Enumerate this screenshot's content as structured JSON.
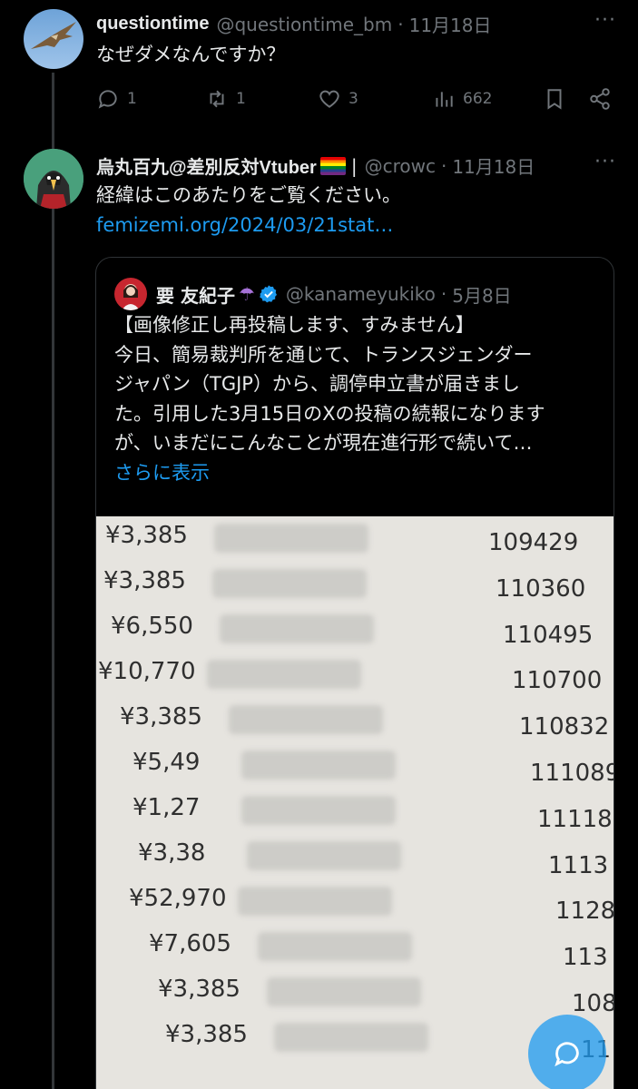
{
  "tweets": [
    {
      "name": "questiontime",
      "handle": "@questiontime_bm",
      "separator": "·",
      "time": "11月18日",
      "more": "···",
      "text": "なぜダメなんですか？",
      "replies": "1",
      "retweets": "1",
      "likes": "3",
      "views": "662"
    },
    {
      "name": "烏丸百九@差別反対Vtuber",
      "pipe": "|",
      "handle": "@crowc",
      "separator": "·",
      "time": "11月18日",
      "more": "···",
      "text": "経緯はこのあたりをご覧ください。",
      "link": "femizemi.org/2024/03/21stat…"
    }
  ],
  "quote": {
    "name": "要 友紀子",
    "umbrella": "☂",
    "handle": "@kanameyukiko",
    "separator": "·",
    "time": "5月8日",
    "lines": [
      "【画像修正し再投稿します、すみません】",
      "今日、簡易裁判所を通じて、トランスジェンダー",
      "ジャパン（TGJP）から、調停申立書が届きまし",
      "た。引用した3月15日のXの投稿の続報になります",
      "が、いまだにこんなことが現在進行形で続いて…"
    ],
    "show_more": "さらに表示"
  },
  "photo_rows": [
    {
      "amount": "¥3,385",
      "number": "109429"
    },
    {
      "amount": "¥3,385",
      "number": "110360"
    },
    {
      "amount": "¥6,550",
      "number": "110495"
    },
    {
      "amount": "¥10,770",
      "number": "110700"
    },
    {
      "amount": "¥3,385",
      "number": "110832"
    },
    {
      "amount": "¥5,49",
      "number": "111089"
    },
    {
      "amount": "¥1,27",
      "number": "11118"
    },
    {
      "amount": "¥3,38",
      "number": "1113"
    },
    {
      "amount": "¥52,970",
      "number": "1128"
    },
    {
      "amount": "¥7,605",
      "number": "113"
    },
    {
      "amount": "¥3,385",
      "number": "108"
    },
    {
      "amount": "¥3,385",
      "number": "11"
    }
  ],
  "colors": {
    "background": "#000000",
    "text": "#e7e9ea",
    "muted": "#71767b",
    "accent": "#1d9bf0",
    "border": "#2f3336"
  },
  "icons": [
    "reply-icon",
    "retweet-icon",
    "like-icon",
    "views-icon",
    "bookmark-icon",
    "share-icon",
    "verified-icon",
    "compose-reply-icon"
  ]
}
